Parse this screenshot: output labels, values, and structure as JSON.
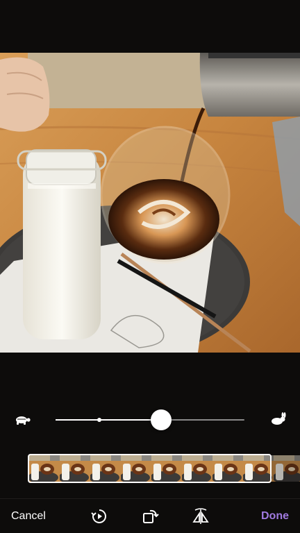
{
  "editor": {
    "cancel_label": "Cancel",
    "done_label": "Done",
    "accent_color": "#a07ae0",
    "speed_value_percent": 56,
    "speed_marker_percent": 23
  },
  "icons": {
    "slow": "turtle-icon",
    "fast": "rabbit-icon",
    "rotate_speed": "rotate-playback-icon",
    "rotate": "rotate-icon",
    "flip": "flip-icon"
  },
  "filmstrip": {
    "frame_count": 9
  }
}
